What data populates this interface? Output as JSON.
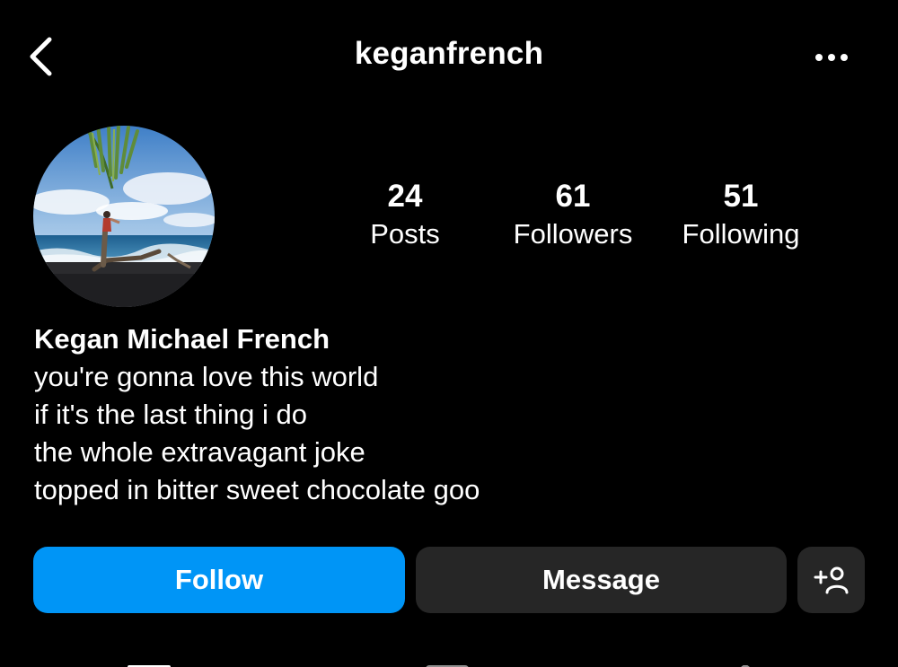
{
  "header": {
    "username": "keganfrench",
    "back_icon": "chevron-left-icon",
    "more_icon": "ellipsis-icon"
  },
  "profile": {
    "avatar_description_icon": "avatar",
    "stats": [
      {
        "value": "24",
        "label": "Posts"
      },
      {
        "value": "61",
        "label": "Followers"
      },
      {
        "value": "51",
        "label": "Following"
      }
    ],
    "name": "Kegan Michael French",
    "bio_lines": [
      "you're gonna love this world",
      "if it's the last thing i do",
      "the whole extravagant joke",
      "topped in bitter sweet chocolate goo"
    ]
  },
  "actions": {
    "follow_label": "Follow",
    "message_label": "Message",
    "add_user_icon": "add-person-icon"
  },
  "colors": {
    "background": "#000000",
    "follow_button": "#0095f6",
    "secondary_button": "#262626",
    "text": "#ffffff"
  },
  "tabs": {
    "icons": [
      "grid-icon",
      "reels-icon",
      "tagged-icon"
    ]
  }
}
